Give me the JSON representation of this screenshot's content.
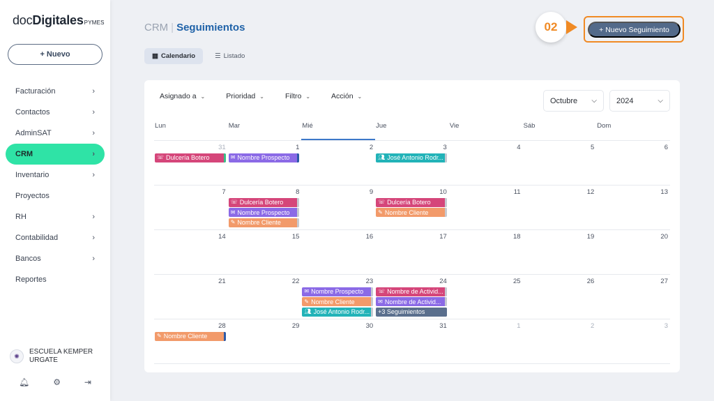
{
  "logo": {
    "doc": "doc",
    "digitales": "Digitales",
    "pymes": "PYMES"
  },
  "sidebar": {
    "new_label": "+ Nuevo",
    "items": [
      {
        "label": "Facturación",
        "chevron": true,
        "active": false
      },
      {
        "label": "Contactos",
        "chevron": true,
        "active": false
      },
      {
        "label": "AdminSAT",
        "chevron": true,
        "active": false
      },
      {
        "label": "CRM",
        "chevron": true,
        "active": true
      },
      {
        "label": "Inventario",
        "chevron": true,
        "active": false
      },
      {
        "label": "Proyectos",
        "chevron": false,
        "active": false
      },
      {
        "label": "RH",
        "chevron": true,
        "active": false
      },
      {
        "label": "Contabilidad",
        "chevron": true,
        "active": false
      },
      {
        "label": "Bancos",
        "chevron": true,
        "active": false
      },
      {
        "label": "Reportes",
        "chevron": false,
        "active": false
      }
    ],
    "school_line1": "ESCUELA KEMPER",
    "school_line2": "URGATE"
  },
  "header": {
    "crumb_root": "CRM",
    "crumb_sep": "|",
    "crumb_current": "Seguimientos",
    "tab_calendar": "Calendario",
    "tab_list": "Listado",
    "step_badge": "02",
    "new_followup": "+ Nuevo Seguimiento"
  },
  "filters": {
    "assigned": "Asignado a",
    "priority": "Prioridad",
    "filter": "Filtro",
    "action": "Acción",
    "month": "Octubre",
    "year": "2024"
  },
  "calendar": {
    "weekdays": [
      "Lun",
      "Mar",
      "Mié",
      "Jue",
      "Vie",
      "Sáb",
      "Dom"
    ],
    "today_index": 2,
    "weeks": [
      [
        {
          "n": "31",
          "muted": true,
          "events": [
            {
              "label": "Dulcería Botero",
              "color": "pink",
              "icon": "phone",
              "edge": "#39c08a"
            }
          ]
        },
        {
          "n": "1",
          "events": []
        },
        {
          "n": "2",
          "events": []
        },
        {
          "n": "3",
          "events": []
        },
        {
          "n": "4",
          "events": []
        },
        {
          "n": "5",
          "events": []
        },
        {
          "n": "6",
          "events": []
        }
      ],
      [
        {
          "n": "7",
          "events": []
        },
        {
          "n": "8",
          "events": []
        },
        {
          "n": "9",
          "events": []
        },
        {
          "n": "10",
          "events": []
        },
        {
          "n": "11",
          "events": []
        },
        {
          "n": "12",
          "events": []
        },
        {
          "n": "13",
          "events": []
        }
      ],
      [
        {
          "n": "14",
          "events": []
        },
        {
          "n": "15",
          "events": []
        },
        {
          "n": "16",
          "events": []
        },
        {
          "n": "17",
          "events": []
        },
        {
          "n": "18",
          "events": []
        },
        {
          "n": "19",
          "events": []
        },
        {
          "n": "20",
          "events": []
        }
      ],
      [
        {
          "n": "21",
          "events": []
        },
        {
          "n": "22",
          "events": []
        },
        {
          "n": "23",
          "events": []
        },
        {
          "n": "24",
          "events": []
        },
        {
          "n": "25",
          "events": []
        },
        {
          "n": "26",
          "events": []
        },
        {
          "n": "27",
          "events": []
        }
      ],
      [
        {
          "n": "28",
          "events": []
        },
        {
          "n": "29",
          "events": []
        },
        {
          "n": "30",
          "events": []
        },
        {
          "n": "31",
          "events": []
        },
        {
          "n": "1",
          "muted": true,
          "events": []
        },
        {
          "n": "2",
          "muted": true,
          "events": []
        },
        {
          "n": "3",
          "muted": true,
          "events": []
        }
      ]
    ],
    "events_by_cell": {
      "0-1": [
        {
          "label": "Nombre Prospecto",
          "color": "purple",
          "icon": "mail",
          "edge": "#2c5aa8"
        }
      ],
      "0-3": [
        {
          "label": "José Antonio Rodr...",
          "color": "teal",
          "icon": "users",
          "edge": "#c6cad2"
        }
      ],
      "1-1": [
        {
          "label": "Dulcería Botero",
          "color": "pink",
          "icon": "phone",
          "edge": "#c6cad2"
        },
        {
          "label": "Nombre Prospecto",
          "color": "purple",
          "icon": "mail",
          "edge": "#c6cad2"
        },
        {
          "label": "Nombre Cliente",
          "color": "orange",
          "icon": "note",
          "edge": "#c6cad2"
        }
      ],
      "1-3": [
        {
          "label": "Dulcería Botero",
          "color": "pink",
          "icon": "phone",
          "edge": "#c6cad2"
        },
        {
          "label": "Nombre Cliente",
          "color": "orange",
          "icon": "note",
          "edge": "#c6cad2"
        }
      ],
      "3-2": [
        {
          "label": "Nombre Prospecto",
          "color": "purple",
          "icon": "mail",
          "edge": "#c6cad2"
        },
        {
          "label": "Nombre Cliente",
          "color": "orange",
          "icon": "note",
          "edge": "#c6cad2"
        },
        {
          "label": "José Antonio Rodr...",
          "color": "teal",
          "icon": "users",
          "edge": "#c6cad2"
        }
      ],
      "3-3": [
        {
          "label": "Nombre de Activid...",
          "color": "pink",
          "icon": "phone",
          "edge": "#c6cad2"
        },
        {
          "label": "Nombre de Activid...",
          "color": "purple",
          "icon": "mail",
          "edge": "#c6cad2"
        },
        {
          "label": "+3 Seguimientos",
          "color": "slate",
          "icon": "",
          "edge": "#5a6f8d"
        }
      ],
      "4-0": [
        {
          "label": "Nombre Cliente",
          "color": "orange",
          "icon": "note",
          "edge": "#2c5aa8"
        }
      ]
    }
  },
  "colors": {
    "accent": "#2fe3a6",
    "primary": "#536a8a",
    "highlight": "#f08a24",
    "link": "#1f62a8"
  }
}
